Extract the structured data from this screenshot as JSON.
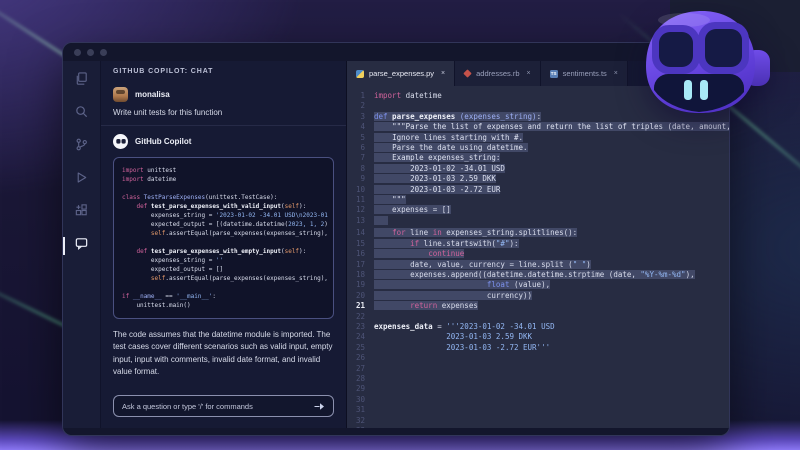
{
  "colors": {
    "background_purple": "#221d44",
    "bottom_glow": "#8a76f2",
    "window_bg": "#161a34",
    "editor_bg": "#272c42",
    "selection": "#414866",
    "keyword_pink": "#d2639c",
    "keyword_blue": "#7d92ef",
    "string_blue": "#93b7f3",
    "mascot_purple": "#6d4de8",
    "teeth_cyan": "#a8e9f7"
  },
  "ui": {
    "close_glyph": "×"
  },
  "activity_bar": {
    "items": [
      {
        "name": "explorer",
        "icon": "files-icon"
      },
      {
        "name": "search",
        "icon": "search-icon"
      },
      {
        "name": "source-control",
        "icon": "branch-icon"
      },
      {
        "name": "run-debug",
        "icon": "play-icon"
      },
      {
        "name": "extensions",
        "icon": "extensions-icon"
      },
      {
        "name": "copilot-chat",
        "icon": "chat-icon",
        "active": true
      }
    ]
  },
  "chat": {
    "header": "GITHUB COPILOT: CHAT",
    "user": {
      "name": "monalisa",
      "message": "Write unit tests for this function"
    },
    "assistant": {
      "name": "GitHub Copilot"
    },
    "code_block": {
      "lines": [
        [
          [
            "kw",
            "import"
          ],
          [
            "pl",
            " unittest"
          ]
        ],
        [
          [
            "kw",
            "import"
          ],
          [
            "pl",
            " datetime"
          ]
        ],
        [],
        [
          [
            "kw",
            "class"
          ],
          [
            "ty",
            " TestParseExpenses"
          ],
          [
            "pl",
            "(unittest.TestCase):"
          ]
        ],
        [
          [
            "pl",
            "    "
          ],
          [
            "kw",
            "def"
          ],
          [
            "fn",
            " test_parse_expenses_with_valid_input"
          ],
          [
            "pl",
            "("
          ],
          [
            "sf",
            "self"
          ],
          [
            "pl",
            "):"
          ]
        ],
        [
          [
            "pl",
            "        expenses_string = "
          ],
          [
            "st",
            "'2023-01-02 -34.01 USD\\n2023-01"
          ]
        ],
        [
          [
            "pl",
            "        expected_output = [(datetime.datetime("
          ],
          [
            "nm",
            "2023, 1, 2"
          ],
          [
            "pl",
            ")"
          ]
        ],
        [
          [
            "pl",
            "        "
          ],
          [
            "sf",
            "self"
          ],
          [
            "pl",
            ".assertEqual(parse_expenses(expenses_string),"
          ]
        ],
        [],
        [
          [
            "pl",
            "    "
          ],
          [
            "kw",
            "def"
          ],
          [
            "fn",
            " test_parse_expenses_with_empty_input"
          ],
          [
            "pl",
            "("
          ],
          [
            "sf",
            "self"
          ],
          [
            "pl",
            "):"
          ]
        ],
        [
          [
            "pl",
            "        expenses_string = "
          ],
          [
            "st",
            "''"
          ]
        ],
        [
          [
            "pl",
            "        expected_output = []"
          ]
        ],
        [
          [
            "pl",
            "        "
          ],
          [
            "sf",
            "self"
          ],
          [
            "pl",
            ".assertEqual(parse_expenses(expenses_string),"
          ]
        ],
        [],
        [
          [
            "kw",
            "if"
          ],
          [
            "pl",
            " "
          ],
          [
            "pr",
            "__name__"
          ],
          [
            "pl",
            " == "
          ],
          [
            "st",
            "'__main__'"
          ],
          [
            "pl",
            ":"
          ]
        ],
        [
          [
            "pl",
            "    unittest.main()"
          ]
        ]
      ]
    },
    "explanation": "The code assumes that the datetime module is imported. The test cases cover different scenarios such as valid input, empty input, input with comments, invalid date format, and invalid value format.",
    "input": {
      "placeholder": "Ask a question or type '/' for commands"
    }
  },
  "editor": {
    "tabs": [
      {
        "label": "parse_expenses.py",
        "icon": "python",
        "icon_text": "",
        "active": true
      },
      {
        "label": "addresses.rb",
        "icon": "ruby",
        "icon_text": "",
        "active": false
      },
      {
        "label": "sentiments.ts",
        "icon": "typescript",
        "icon_text": "TS",
        "active": false
      }
    ],
    "total_lines": 34,
    "cursor_line": 21,
    "lines": [
      {
        "n": 1,
        "sel": false,
        "seg": [
          [
            "kw",
            "import"
          ],
          [
            "pl",
            " datetime"
          ]
        ]
      },
      {
        "n": 2,
        "sel": false,
        "seg": []
      },
      {
        "n": 3,
        "sel": true,
        "seg": [
          [
            "kb",
            "def"
          ],
          [
            "fn",
            " parse_expenses "
          ],
          [
            "pr",
            "(expenses_string)"
          ],
          [
            "pl",
            ":"
          ]
        ]
      },
      {
        "n": 4,
        "sel": true,
        "seg": [
          [
            "pl",
            "    "
          ],
          [
            "dc",
            "\"\"\"Parse the list of expenses and return the list of triples (date, amount, currency"
          ]
        ]
      },
      {
        "n": 5,
        "sel": true,
        "seg": [
          [
            "pl",
            "    "
          ],
          [
            "dc",
            "Ignore lines starting with #."
          ]
        ]
      },
      {
        "n": 6,
        "sel": true,
        "seg": [
          [
            "pl",
            "    "
          ],
          [
            "dc",
            "Parse the date using datetime."
          ]
        ]
      },
      {
        "n": 7,
        "sel": true,
        "seg": [
          [
            "pl",
            "    "
          ],
          [
            "dc",
            "Example expenses_string:"
          ]
        ]
      },
      {
        "n": 8,
        "sel": true,
        "seg": [
          [
            "pl",
            "        "
          ],
          [
            "dc",
            "2023-01-02 -34.01 USD"
          ]
        ]
      },
      {
        "n": 9,
        "sel": true,
        "seg": [
          [
            "pl",
            "        "
          ],
          [
            "dc",
            "2023-01-03 2.59 DKK"
          ]
        ]
      },
      {
        "n": 10,
        "sel": true,
        "seg": [
          [
            "pl",
            "        "
          ],
          [
            "dc",
            "2023-01-03 -2.72 EUR"
          ]
        ]
      },
      {
        "n": 11,
        "sel": true,
        "seg": [
          [
            "pl",
            "    "
          ],
          [
            "dc",
            "\"\"\""
          ]
        ]
      },
      {
        "n": 12,
        "sel": true,
        "seg": [
          [
            "pl",
            "    expenses = []"
          ]
        ]
      },
      {
        "n": 13,
        "sel": true,
        "seg": []
      },
      {
        "n": 14,
        "sel": true,
        "seg": [
          [
            "pl",
            "    "
          ],
          [
            "kw",
            "for"
          ],
          [
            "pl",
            " line "
          ],
          [
            "kw",
            "in"
          ],
          [
            "pl",
            " expenses_string.splitlines():"
          ]
        ]
      },
      {
        "n": 15,
        "sel": true,
        "seg": [
          [
            "pl",
            "        "
          ],
          [
            "kw",
            "if"
          ],
          [
            "pl",
            " line.startswith("
          ],
          [
            "st",
            "\"#\""
          ],
          [
            "pl",
            "):"
          ]
        ]
      },
      {
        "n": 16,
        "sel": true,
        "seg": [
          [
            "pl",
            "            "
          ],
          [
            "kw",
            "continue"
          ]
        ]
      },
      {
        "n": 17,
        "sel": true,
        "seg": [
          [
            "pl",
            "        date, value, currency = line.split ("
          ],
          [
            "st",
            "\" \""
          ],
          [
            "pl",
            ")"
          ]
        ]
      },
      {
        "n": 18,
        "sel": true,
        "seg": [
          [
            "pl",
            "        expenses.append((datetime.datetime.strptime (date, "
          ],
          [
            "st",
            "\"%Y-%m-%d\""
          ],
          [
            "pl",
            "),"
          ]
        ]
      },
      {
        "n": 19,
        "sel": true,
        "seg": [
          [
            "pl",
            "                         "
          ],
          [
            "kb",
            "float"
          ],
          [
            "pl",
            " (value),"
          ]
        ]
      },
      {
        "n": 20,
        "sel": true,
        "seg": [
          [
            "pl",
            "                         currency))"
          ]
        ]
      },
      {
        "n": 21,
        "sel": true,
        "seg": [
          [
            "pl",
            "        "
          ],
          [
            "kw",
            "return"
          ],
          [
            "pl",
            " expenses"
          ]
        ]
      },
      {
        "n": 22,
        "sel": false,
        "seg": []
      },
      {
        "n": 23,
        "sel": false,
        "seg": [
          [
            "fn",
            "expenses_data"
          ],
          [
            "pl",
            " = "
          ],
          [
            "st",
            "'''2023-01-02 -34.01 USD"
          ]
        ]
      },
      {
        "n": 24,
        "sel": false,
        "seg": [
          [
            "st",
            "                2023-01-03 2.59 DKK"
          ]
        ]
      },
      {
        "n": 25,
        "sel": false,
        "seg": [
          [
            "st",
            "                2023-01-03 -2.72 EUR'''"
          ]
        ]
      }
    ]
  }
}
